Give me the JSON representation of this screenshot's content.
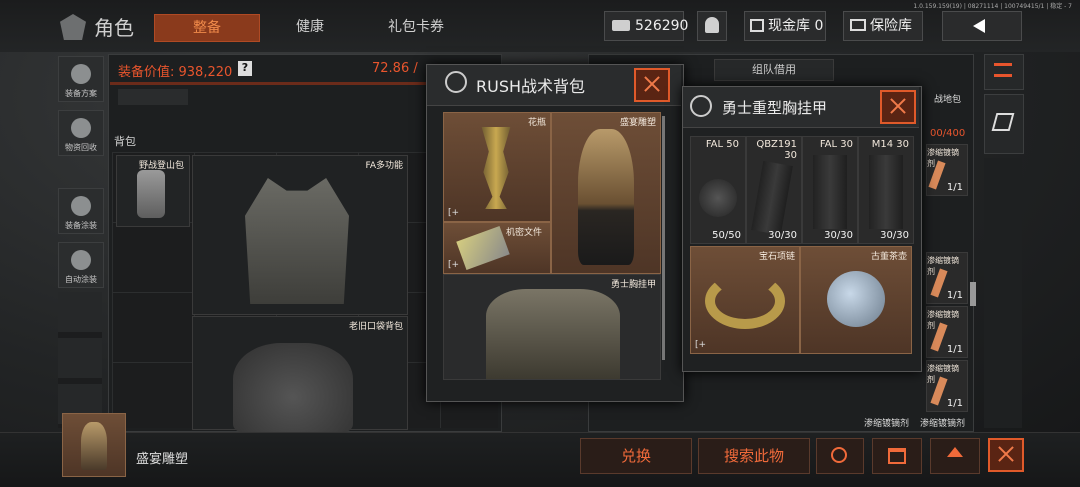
{
  "version": "1.0.159.159(19) | 08271114 | 100749415/1 | 稳定 - 7",
  "header": {
    "title": "角色",
    "tabs": [
      "整备",
      "健康",
      "礼包卡券"
    ],
    "active_tab": 0,
    "currency_value": "526290",
    "cash_vault": "现金库 0",
    "safe_box": "保险库"
  },
  "sidebar": [
    "装备方案",
    "物资回收",
    "装备涂装",
    "自动涂装"
  ],
  "left": {
    "equip_value_label": "装备价值: 938,220",
    "help": "?",
    "weight": "72.86 / ",
    "backpack_label": "背包",
    "items": [
      "野战登山包",
      "FA多功能",
      "老旧口袋背包"
    ]
  },
  "right_top": {
    "team_borrow": "组队借用",
    "rig_label": "战地包",
    "rig_cap": "00/400"
  },
  "rush_panel": {
    "title": "RUSH战术背包",
    "items": [
      "花瓶",
      "盛宴雕塑",
      "机密文件",
      "勇士胸挂甲"
    ]
  },
  "rig_panel": {
    "title": "勇士重型胸挂甲",
    "mags": [
      {
        "name": "FAL 50",
        "count": "50/50"
      },
      {
        "name": "QBZ191 30",
        "count": "30/30"
      },
      {
        "name": "FAL 30",
        "count": "30/30"
      },
      {
        "name": "M14 30",
        "count": "30/30"
      }
    ],
    "valuables": [
      "宝石项链",
      "古董茶壶"
    ]
  },
  "ammo_column": {
    "label": "渗缩镀镝剂",
    "count": "1/1"
  },
  "footer": {
    "selected_item": "盛宴雕塑",
    "exchange": "兑换",
    "search_item": "搜索此物"
  },
  "colors": {
    "accent": "#e8552d",
    "brown_cell": "#6e4e37",
    "panel": "#1d1f20"
  }
}
